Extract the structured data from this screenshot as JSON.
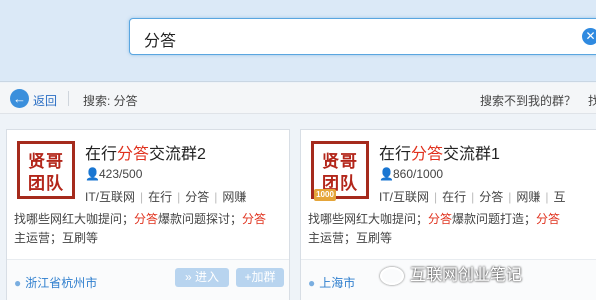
{
  "search": {
    "value": "分答",
    "clear_glyph": "✕"
  },
  "nav": {
    "back_label": "返回",
    "search_crumb": "搜索: 分答",
    "not_found": "搜索不到我的群？",
    "cut_text": "找"
  },
  "cards": [
    {
      "logo_line1": "贤哥",
      "logo_line2": "团队",
      "logo_badge": "",
      "name_pre": "在行",
      "name_hl": "分答",
      "name_post": "交流群2",
      "members": "423/500",
      "tags": [
        "IT/互联网",
        "在行",
        "分答",
        "网赚"
      ],
      "desc": [
        {
          "t": "找哪些网红大咖提问；",
          "hl": false
        },
        {
          "t": "分答",
          "hl": true
        },
        {
          "t": "爆款问题探讨；",
          "hl": false
        },
        {
          "t": "分答",
          "hl": true
        },
        {
          "t": "主运营；互刷等",
          "hl": false
        }
      ],
      "location": "浙江省杭州市",
      "enter_label": "» 进入",
      "join_label": "+加群"
    },
    {
      "logo_line1": "贤哥",
      "logo_line2": "团队",
      "logo_badge": "1000",
      "name_pre": "在行",
      "name_hl": "分答",
      "name_post": "交流群1",
      "members": "860/1000",
      "tags": [
        "IT/互联网",
        "在行",
        "分答",
        "网赚",
        "互"
      ],
      "desc": [
        {
          "t": "找哪些网红大咖提问；",
          "hl": false
        },
        {
          "t": "分答",
          "hl": true
        },
        {
          "t": "爆款问题打造；",
          "hl": false
        },
        {
          "t": "分答",
          "hl": true
        },
        {
          "t": "主运营；互刷等",
          "hl": false
        }
      ],
      "location": "上海市"
    }
  ],
  "watermark": "互联网创业笔记",
  "colors": {
    "accent": "#2f8ae0",
    "highlight": "#e0321e",
    "logo": "#a52a1c"
  }
}
